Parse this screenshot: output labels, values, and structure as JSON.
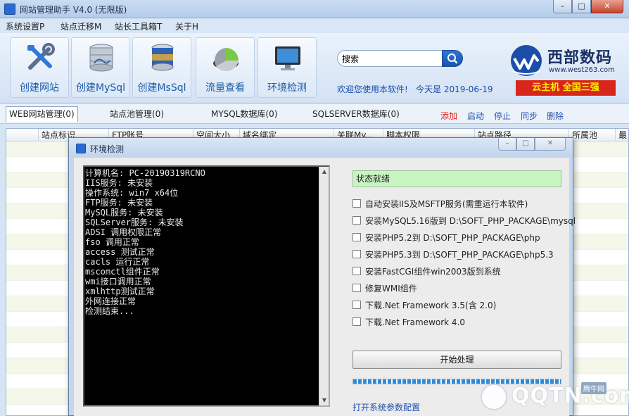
{
  "window": {
    "title": "网站管理助手 V4.0 (无限版)",
    "minimize_label": "–",
    "maximize_label": "□",
    "close_label": "✕"
  },
  "menu": [
    "系统设置P",
    "站点迁移M",
    "站长工具箱T",
    "关于H"
  ],
  "toolbar": {
    "buttons": [
      {
        "label": "创建网站",
        "icon": "tools-icon"
      },
      {
        "label": "创建MySql",
        "icon": "database-icon"
      },
      {
        "label": "创建MsSql",
        "icon": "database-stack-icon"
      },
      {
        "label": "流量查看",
        "icon": "pie-chart-icon"
      },
      {
        "label": "环境检测",
        "icon": "monitor-icon"
      }
    ],
    "search_value": "搜索",
    "welcome": "欢迎您使用本软件!",
    "today": "今天是 2019-06-19"
  },
  "brand": {
    "name": "西部数码",
    "url": "www.west263.com",
    "promo": "云主机 全国三强",
    "accent": "#d8261a"
  },
  "tabs": [
    "WEB网站管理(0)",
    "站点池管理(0)",
    "MYSQL数据库(0)",
    "SQLSERVER数据库(0)"
  ],
  "actions": [
    "添加",
    "启动",
    "停止",
    "同步",
    "删除"
  ],
  "table": {
    "columns": [
      "",
      "站点标识",
      "FTP账号",
      "空间大小",
      "域名绑定",
      "关联My...",
      "脚本权限",
      "站点路径",
      "所属池",
      "最"
    ]
  },
  "dialog": {
    "title": "环境检测",
    "console_lines": [
      "计算机名: PC-20190319RCNO",
      "IIS服务: 未安装",
      "操作系统: win7 x64位",
      "FTP服务: 未安装",
      "MySQL服务: 未安装",
      "SQLServer服务: 未安装",
      "ADSI 调用权限正常",
      "fso 调用正常",
      "access 测试正常",
      "cacls 运行正常",
      "mscomctl组件正常",
      "wmi接口调用正常",
      "xmlhttp测试正常",
      "外网连接正常",
      "检测结束..."
    ],
    "status": "状态就绪",
    "status_color": "#c8f5c2",
    "options": [
      {
        "label": "自动安装IIS及MSFTP服务(需重运行本软件)",
        "checked": false
      },
      {
        "label": "安装MySQL5.16版到 D:\\SOFT_PHP_PACKAGE\\mysql",
        "checked": false
      },
      {
        "label": "安装PHP5.2到 D:\\SOFT_PHP_PACKAGE\\php",
        "checked": false
      },
      {
        "label": "安装PHP5.3到 D:\\SOFT_PHP_PACKAGE\\php5.3",
        "checked": false
      },
      {
        "label": "安装FastCGI组件win2003版到系统",
        "checked": false
      },
      {
        "label": "修复WMI组件",
        "checked": false
      },
      {
        "label": "下载.Net Framework 3.5(含 2.0)",
        "checked": false
      },
      {
        "label": "下载.Net Framework 4.0",
        "checked": false
      }
    ],
    "start_button": "开始处理",
    "progress": 1.0,
    "config_link": "打开系统参数配置"
  },
  "watermark": {
    "text": "QQTN.com",
    "badge": "腾牛网"
  }
}
